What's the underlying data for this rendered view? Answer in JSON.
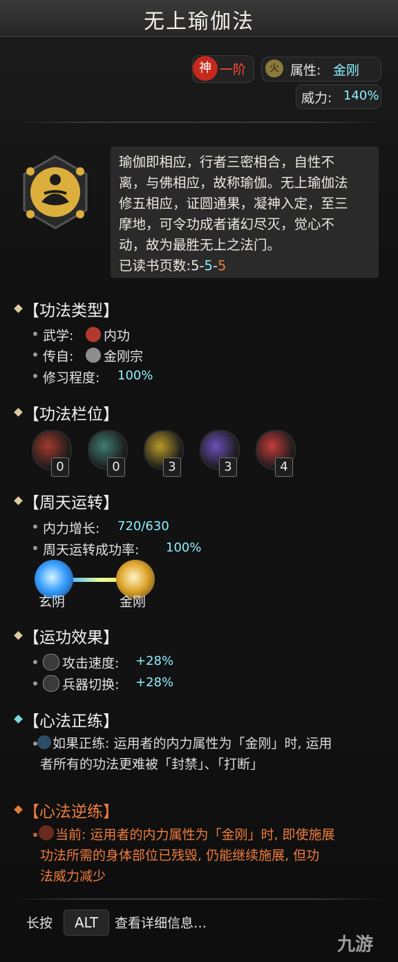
{
  "title": "无上瑜伽法",
  "grade": {
    "god_label": "神",
    "rank": "一阶"
  },
  "attribute": {
    "icon_glyph": "火",
    "label": "属性:",
    "value": "金刚"
  },
  "power": {
    "label": "威力:",
    "value": "140%"
  },
  "description": [
    "瑜伽即相应，行者三密相合，自性不",
    "离，与佛相应，故称瑜伽。无上瑜伽法",
    "修五相应，证圆通果，凝神入定，至三",
    "摩地，可令功成者诸幻尽灭，觉心不",
    "动，故为最胜无上之法门。"
  ],
  "pages_read": {
    "label": "已读书页数:",
    "v1": "5-",
    "v2": "5",
    "sep": "-",
    "v3": "5"
  },
  "sections": {
    "type": {
      "title": "【功法类型】",
      "martial": {
        "label": "武学:",
        "value": "内功"
      },
      "source": {
        "label": "传自:",
        "value": "金刚宗"
      },
      "practice": {
        "label": "修习程度:",
        "value": "100%"
      }
    },
    "slots": {
      "title": "【功法栏位】",
      "items": [
        {
          "count": "0",
          "color": "#a33a2c"
        },
        {
          "count": "0",
          "color": "#3f7c74"
        },
        {
          "count": "3",
          "color": "#b89a2a"
        },
        {
          "count": "3",
          "color": "#6a4fb8"
        },
        {
          "count": "4",
          "color": "#c33b3b"
        }
      ]
    },
    "cycle": {
      "title": "【周天运转】",
      "growth": {
        "label": "内力增长:",
        "value": "720/630"
      },
      "rate": {
        "label": "周天运转成功率:",
        "value": "100%"
      },
      "orb_left": "玄阴",
      "orb_right": "金刚"
    },
    "effects": {
      "title": "【运功效果】",
      "items": [
        {
          "label": "攻击速度:",
          "value": "+28%"
        },
        {
          "label": "兵器切换:",
          "value": "+28%"
        }
      ]
    },
    "forward": {
      "title": "【心法正练】",
      "lines": [
        "如果正练: 运用者的内力属性为「金刚」时, 运用",
        "者所有的功法更难被「封禁」、「打断」"
      ]
    },
    "reverse": {
      "title": "【心法逆练】",
      "lines": [
        "当前: 运用者的内力属性为「金刚」时, 即使施展",
        "功法所需的身体部位已残毁, 仍能继续施展, 但功",
        "法威力减少"
      ]
    }
  },
  "footer": {
    "hold": "长按",
    "key": "ALT",
    "hint": "查看详细信息…"
  },
  "watermark": "九游",
  "colors": {
    "accent_cyan": "#8ef0ff",
    "orange": "#f07c3c",
    "gold": "#d8b04a"
  }
}
